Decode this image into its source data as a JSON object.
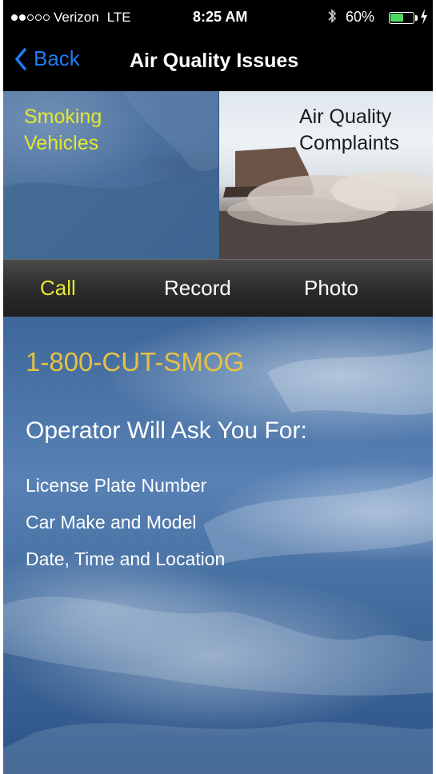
{
  "status_bar": {
    "carrier": "Verizon",
    "network": "LTE",
    "time": "8:25 AM",
    "battery_percent": "60%",
    "battery_level": 0.6,
    "signal_bars": 2,
    "signal_total": 5,
    "icons": [
      "bluetooth-icon",
      "battery-icon",
      "charging-icon"
    ]
  },
  "nav": {
    "back_label": "Back",
    "title": "Air Quality Issues"
  },
  "tiles": [
    {
      "label_line1": "Smoking",
      "label_line2": "Vehicles",
      "color": "#e5e82e"
    },
    {
      "label_line1": "Air Quality",
      "label_line2": "Complaints",
      "color": "#1a1a1a"
    }
  ],
  "menu": {
    "items": [
      "Call",
      "Record",
      "Photo"
    ],
    "active": "Call",
    "active_color": "#e5e82e"
  },
  "content": {
    "phone_number": "1-800-CUT-SMOG",
    "heading": "Operator Will Ask You For:",
    "items": [
      "License Plate Number",
      "Car Make and Model",
      "Date, Time and Location"
    ]
  },
  "colors": {
    "accent_blue": "#1e7cf2",
    "phone_gold": "#e7c142",
    "battery_green": "#4cd964"
  }
}
